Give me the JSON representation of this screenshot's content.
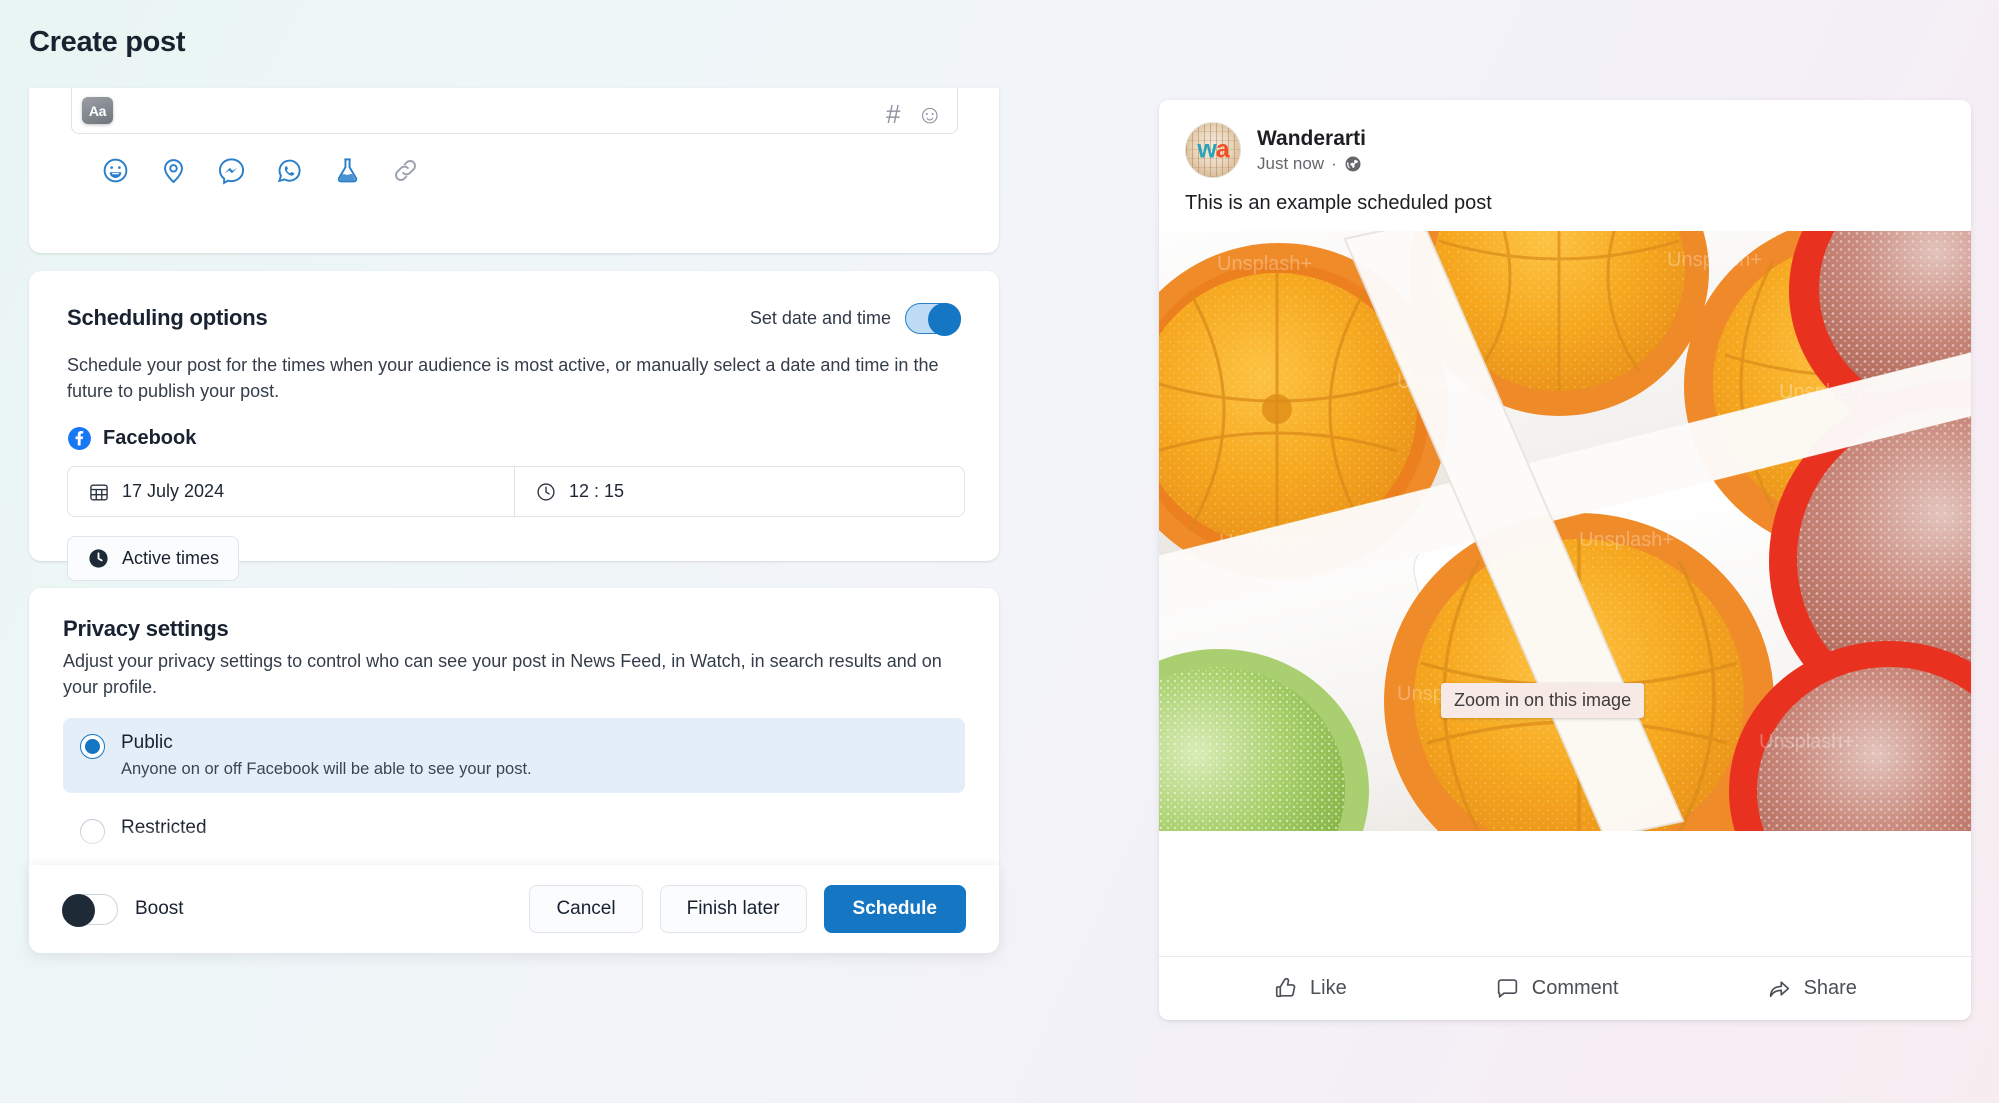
{
  "page": {
    "title": "Create post"
  },
  "composer": {
    "text_style_label": "Aa",
    "right_icons": [
      {
        "name": "hashtag-icon",
        "glyph": "#"
      },
      {
        "name": "emoji-icon",
        "glyph": "☺"
      }
    ],
    "toolbar_icons": [
      {
        "name": "feeling-activity-icon",
        "label": "Feeling/activity",
        "color": "#2a7fc9"
      },
      {
        "name": "location-icon",
        "label": "Check in",
        "color": "#2a7fc9"
      },
      {
        "name": "messenger-icon",
        "label": "Messenger",
        "color": "#2a7fc9"
      },
      {
        "name": "whatsapp-icon",
        "label": "WhatsApp",
        "color": "#2a7fc9"
      },
      {
        "name": "flask-icon",
        "label": "Experiment",
        "color": "#2a7fc9"
      },
      {
        "name": "link-icon",
        "label": "Link",
        "color": "#9aa2ad"
      }
    ]
  },
  "scheduling": {
    "title": "Scheduling options",
    "toggle_label": "Set date and time",
    "toggle_on": true,
    "description": "Schedule your post for the times when your audience is most active, or manually select a date and time in the future to publish your post.",
    "network": "Facebook",
    "date_value": "17 July 2024",
    "time_value": "12 : 15",
    "active_times_label": "Active times"
  },
  "privacy": {
    "title": "Privacy settings",
    "description": "Adjust your privacy settings to control who can see your post in News Feed, in Watch, in search results and on your profile.",
    "options": [
      {
        "label": "Public",
        "sub": "Anyone on or off Facebook will be able to see your post.",
        "selected": true
      },
      {
        "label": "Restricted",
        "sub": "",
        "selected": false
      }
    ]
  },
  "footer": {
    "boost_label": "Boost",
    "boost_on": false,
    "cancel_label": "Cancel",
    "finish_later_label": "Finish later",
    "schedule_label": "Schedule",
    "primary_color": "#1577c4"
  },
  "preview": {
    "account_name": "Wanderarti",
    "avatar_initials_left": "w",
    "avatar_initials_right": "a",
    "timestamp": "Just now",
    "separator": "·",
    "audience_icon": "globe-icon",
    "post_text": "This is an example scheduled post",
    "image_tooltip": "Zoom in on this image",
    "image_watermarks": [
      "Unsplash+",
      "Unsplash+",
      "Unsplash+",
      "Unsplash+",
      "Unsplash+",
      "Unsplash+",
      "Unsplash+",
      "Unsplash+"
    ],
    "actions": [
      {
        "icon": "thumbs-up-icon",
        "label": "Like"
      },
      {
        "icon": "comment-bubble-icon",
        "label": "Comment"
      },
      {
        "icon": "share-arrow-icon",
        "label": "Share"
      }
    ]
  }
}
